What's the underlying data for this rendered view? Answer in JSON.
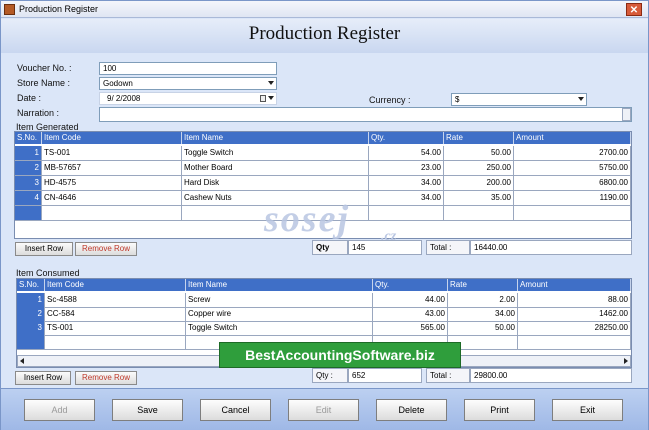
{
  "window": {
    "title": "Production Register",
    "close_glyph": "✕"
  },
  "header": {
    "title": "Production Register"
  },
  "form": {
    "voucher_label": "Voucher No. :",
    "voucher_value": "100",
    "store_label": "Store Name :",
    "store_value": "Godown",
    "date_label": "Date :",
    "date_value": "9/ 2/2008",
    "narration_label": "Narration :",
    "narration_value": "",
    "currency_label": "Currency :",
    "currency_value": "$"
  },
  "item_generated": {
    "section_label": "Item Generated",
    "columns": [
      "S.No.",
      "Item Code",
      "Item Name",
      "Qty.",
      "Rate",
      "Amount"
    ],
    "rows": [
      {
        "sno": "1",
        "code": "TS-001",
        "name": "Toggle Switch",
        "qty": "54.00",
        "rate": "50.00",
        "amount": "2700.00"
      },
      {
        "sno": "2",
        "code": "MB-57657",
        "name": "Mother Board",
        "qty": "23.00",
        "rate": "250.00",
        "amount": "5750.00"
      },
      {
        "sno": "3",
        "code": "HD-4575",
        "name": "Hard Disk",
        "qty": "34.00",
        "rate": "200.00",
        "amount": "6800.00"
      },
      {
        "sno": "4",
        "code": "CN-4646",
        "name": "Cashew Nuts",
        "qty": "34.00",
        "rate": "35.00",
        "amount": "1190.00"
      }
    ],
    "insert_label": "Insert Row",
    "remove_label": "Remove Row",
    "qty_label": "Qty",
    "qty_value": "145",
    "total_label": "Total :",
    "total_value": "16440.00"
  },
  "item_consumed": {
    "section_label": "Item Consumed",
    "columns": [
      "S.No.",
      "Item Code",
      "Item Name",
      "Qty.",
      "Rate",
      "Amount"
    ],
    "rows": [
      {
        "sno": "1",
        "code": "Sc-4588",
        "name": "Screw",
        "qty": "44.00",
        "rate": "2.00",
        "amount": "88.00"
      },
      {
        "sno": "2",
        "code": "CC-584",
        "name": "Copper wire",
        "qty": "43.00",
        "rate": "34.00",
        "amount": "1462.00"
      },
      {
        "sno": "3",
        "code": "TS-001",
        "name": "Toggle Switch",
        "qty": "565.00",
        "rate": "50.00",
        "amount": "28250.00"
      }
    ],
    "insert_label": "Insert Row",
    "remove_label": "Remove Row",
    "qty_label": "Qty :",
    "qty_value": "652",
    "total_label": "Total :",
    "total_value": "29800.00"
  },
  "buttons": {
    "add": "Add",
    "save": "Save",
    "cancel": "Cancel",
    "edit": "Edit",
    "delete": "Delete",
    "print": "Print",
    "exit": "Exit"
  },
  "watermark": {
    "text": "sosej",
    "suffix": ".cz"
  },
  "banner": {
    "text": "BestAccountingSoftware.biz"
  },
  "colors": {
    "grid_header": "#3f6fc7",
    "banner": "#2f9e3c",
    "background": "#dbe6f8"
  }
}
